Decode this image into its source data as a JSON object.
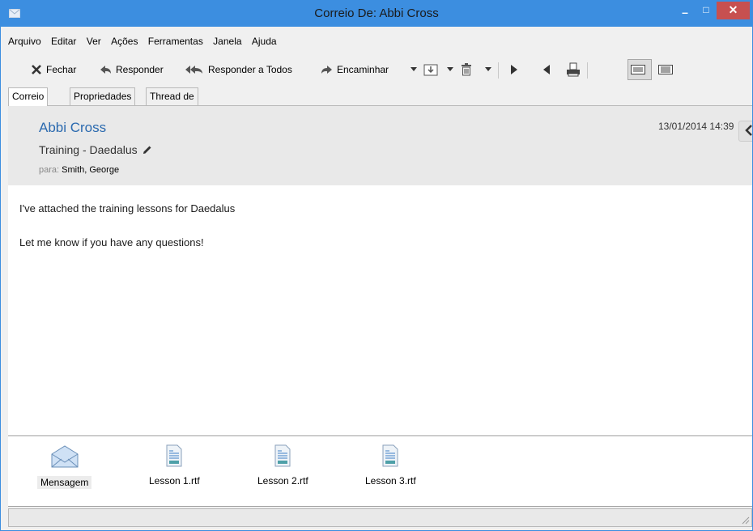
{
  "window": {
    "title": "Correio De: Abbi Cross"
  },
  "window_controls": {
    "minimize": "–",
    "maximize": "□",
    "close": "✕"
  },
  "menubar": {
    "items": [
      "Arquivo",
      "Editar",
      "Ver",
      "Ações",
      "Ferramentas",
      "Janela",
      "Ajuda"
    ]
  },
  "toolbar": {
    "close_label": "Fechar",
    "reply_label": "Responder",
    "reply_all_label": "Responder a Todos",
    "forward_label": "Encaminhar"
  },
  "tabs": [
    "Correio",
    "Propriedades",
    "Thread de Discussão"
  ],
  "message": {
    "sender": "Abbi Cross",
    "subject": "Training - Daedalus",
    "to_label": "para:",
    "to_value": "Smith, George",
    "date": "13/01/2014 14:39",
    "body_lines": [
      "I've attached the training lessons for Daedalus",
      "Let me know if you have any questions!"
    ]
  },
  "attachments": [
    "Mensagem",
    "Lesson 1.rtf",
    "Lesson 2.rtf",
    "Lesson 3.rtf"
  ],
  "colors": {
    "titlebar": "#3c8ee0",
    "sender": "#2b6aaf",
    "close_button": "#c75050",
    "header_bg": "#e9e9e9"
  },
  "icons": {
    "app": "envelope-icon",
    "close": "close-x-icon",
    "reply": "reply-arrow-icon",
    "reply_all": "reply-all-icon",
    "forward": "forward-arrow-icon",
    "move": "move-to-folder-icon",
    "delete": "trash-icon",
    "next": "next-triangle-icon",
    "prev": "previous-triangle-icon",
    "print": "print-icon",
    "view_a": "view-layout-icon",
    "view_b": "view-layout-icon",
    "edit_subject": "pencil-icon",
    "collapse": "chevron-left-icon"
  }
}
